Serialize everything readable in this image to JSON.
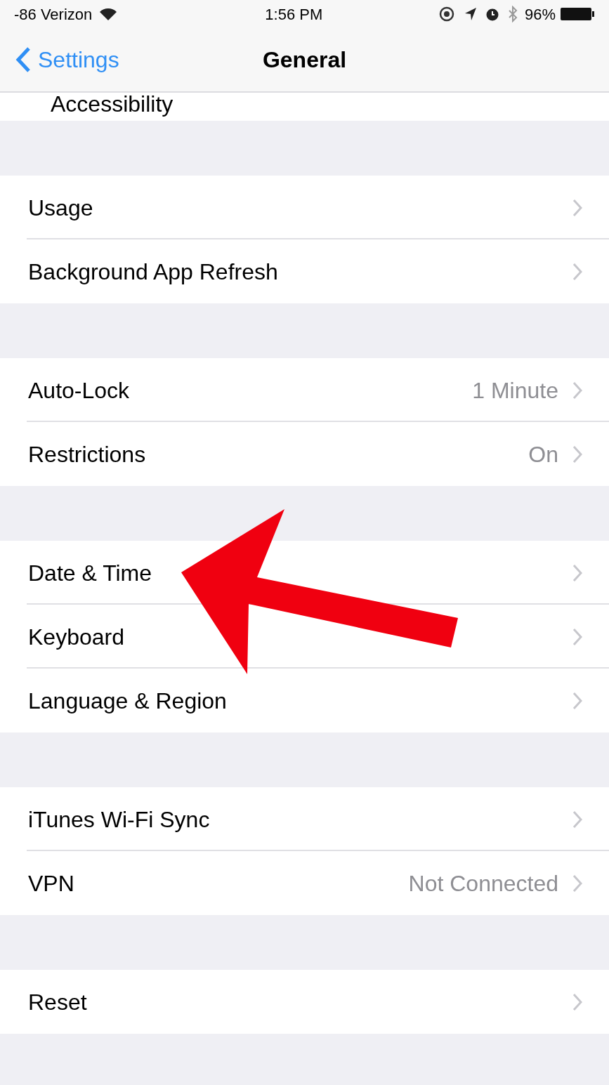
{
  "status_bar": {
    "carrier": "-86 Verizon",
    "time": "1:56 PM",
    "battery": "96%"
  },
  "nav_bar": {
    "back": "Settings",
    "title": "General"
  },
  "partial_row": {
    "label": "Accessibility"
  },
  "groups": [
    [
      {
        "label": "Usage"
      },
      {
        "label": "Background App Refresh"
      }
    ],
    [
      {
        "label": "Auto-Lock",
        "value": "1 Minute"
      },
      {
        "label": "Restrictions",
        "value": "On"
      }
    ],
    [
      {
        "label": "Date & Time"
      },
      {
        "label": "Keyboard"
      },
      {
        "label": "Language & Region"
      }
    ],
    [
      {
        "label": "iTunes Wi-Fi Sync"
      },
      {
        "label": "VPN",
        "value": "Not Connected"
      }
    ],
    [
      {
        "label": "Reset"
      }
    ]
  ]
}
